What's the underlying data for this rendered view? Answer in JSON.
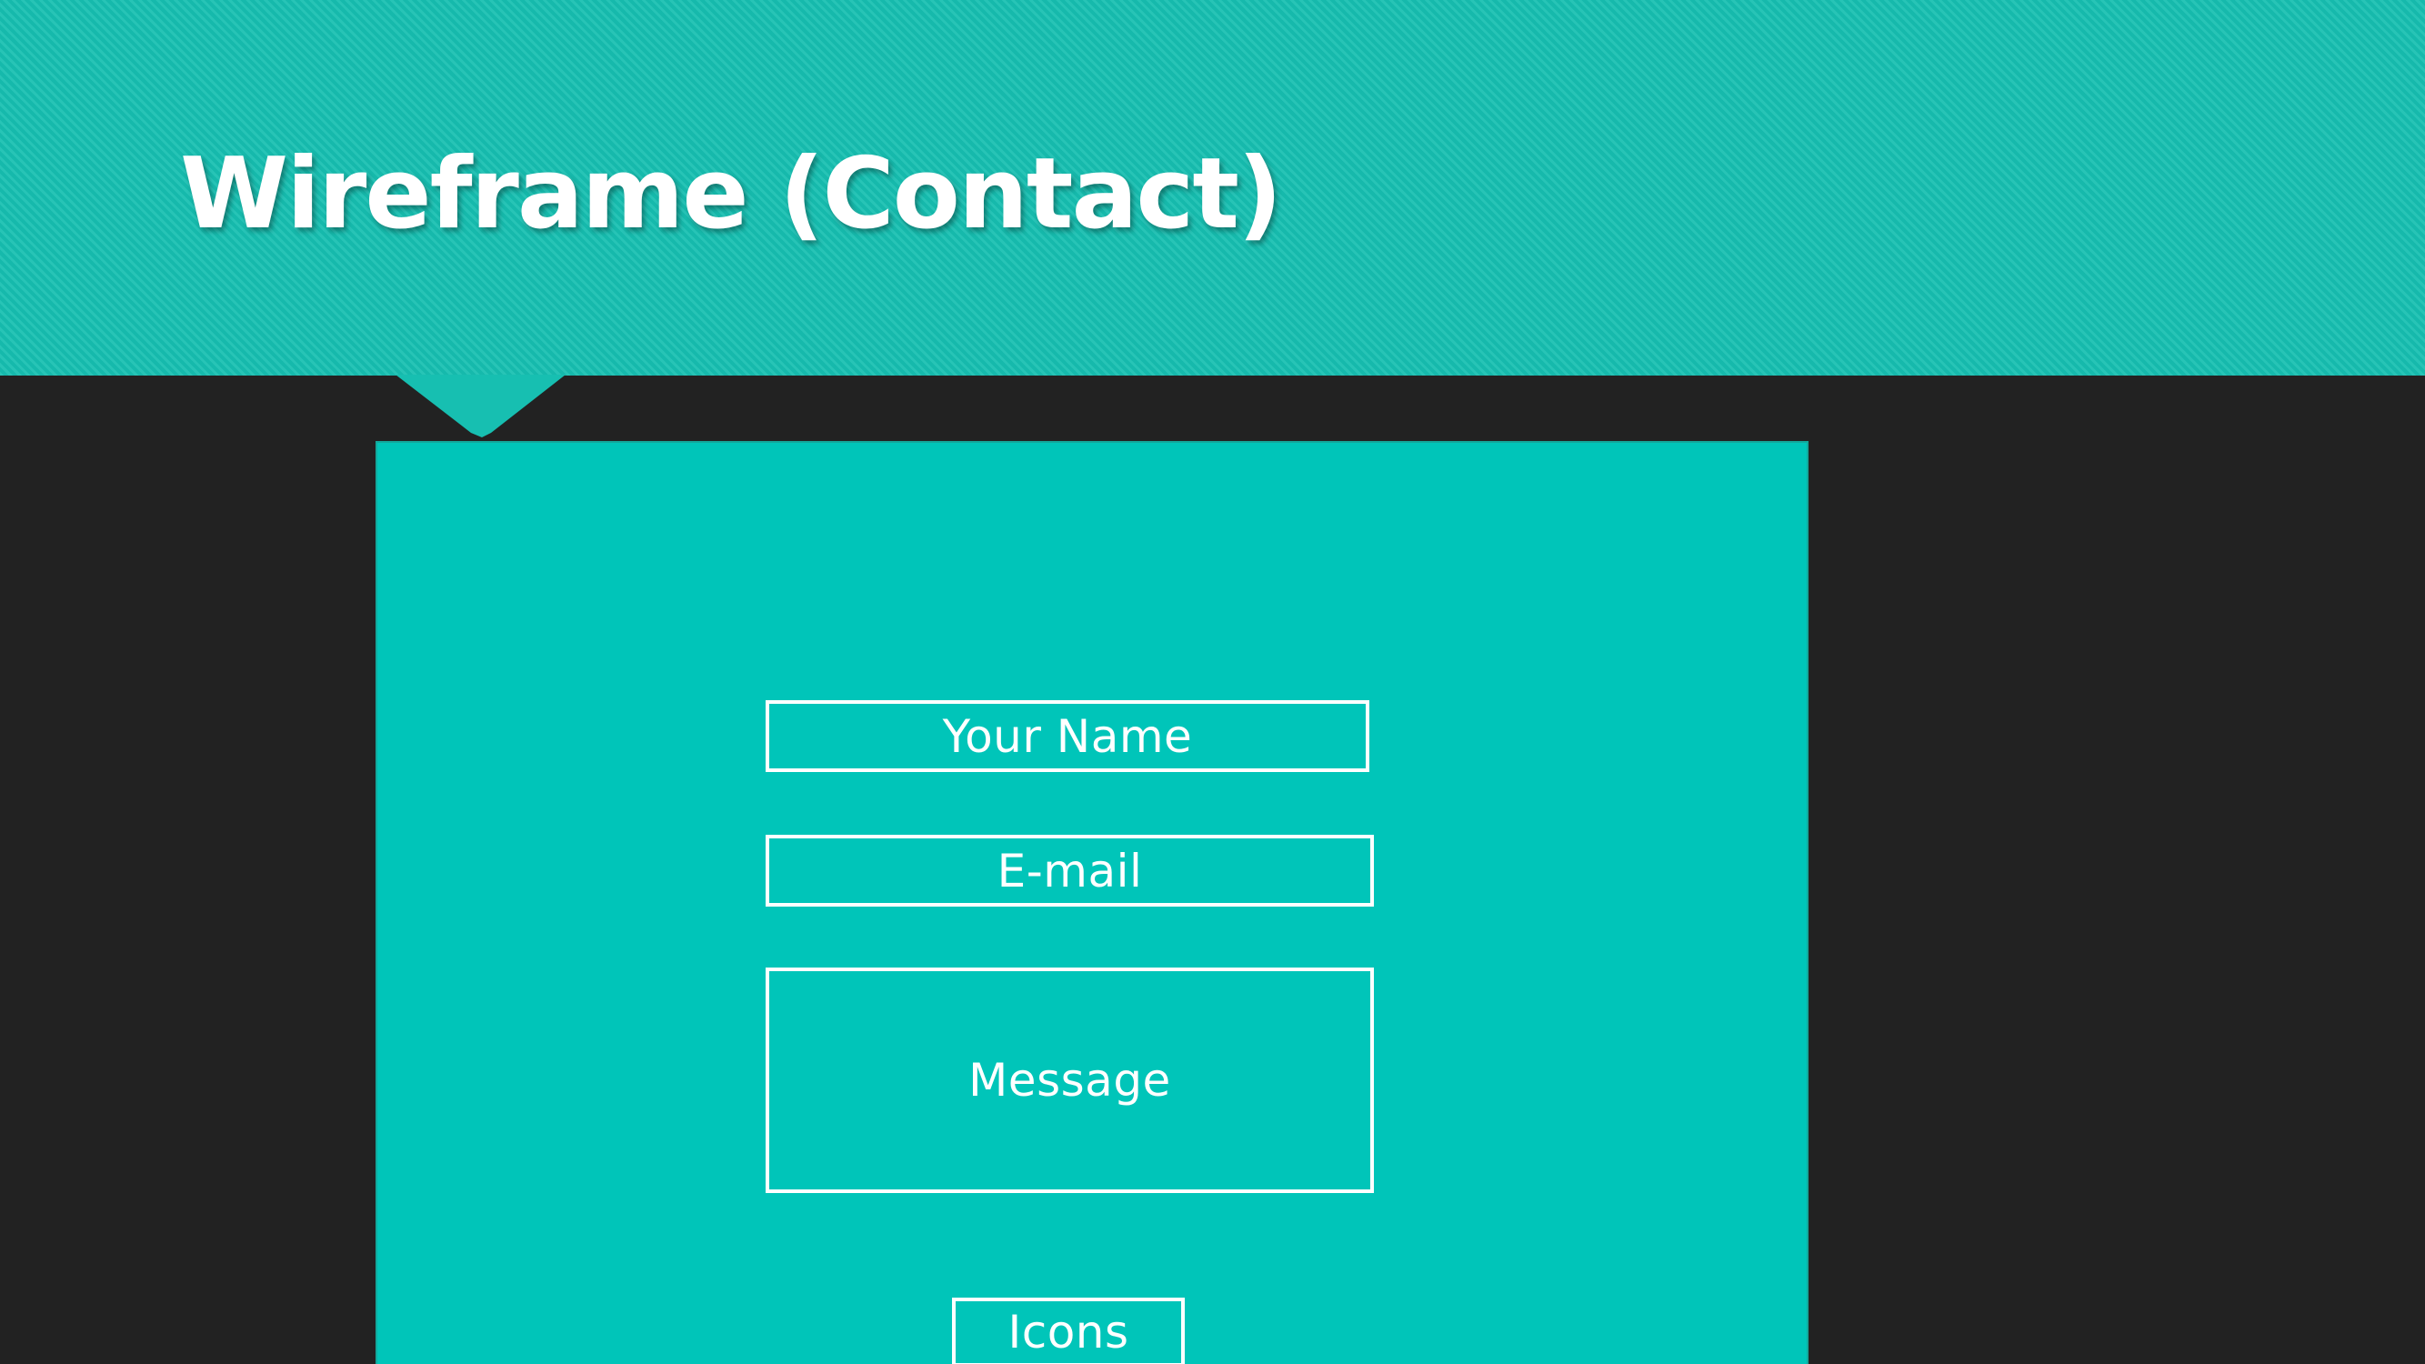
{
  "slide": {
    "title": "Wireframe (Contact)"
  },
  "form": {
    "name_placeholder": "Your Name",
    "email_placeholder": "E-mail",
    "message_placeholder": "Message",
    "icons_label": "Icons"
  },
  "colors": {
    "banner": "#17bfb1",
    "background": "#222222",
    "frame": "#00c5b9",
    "text": "#ffffff"
  }
}
